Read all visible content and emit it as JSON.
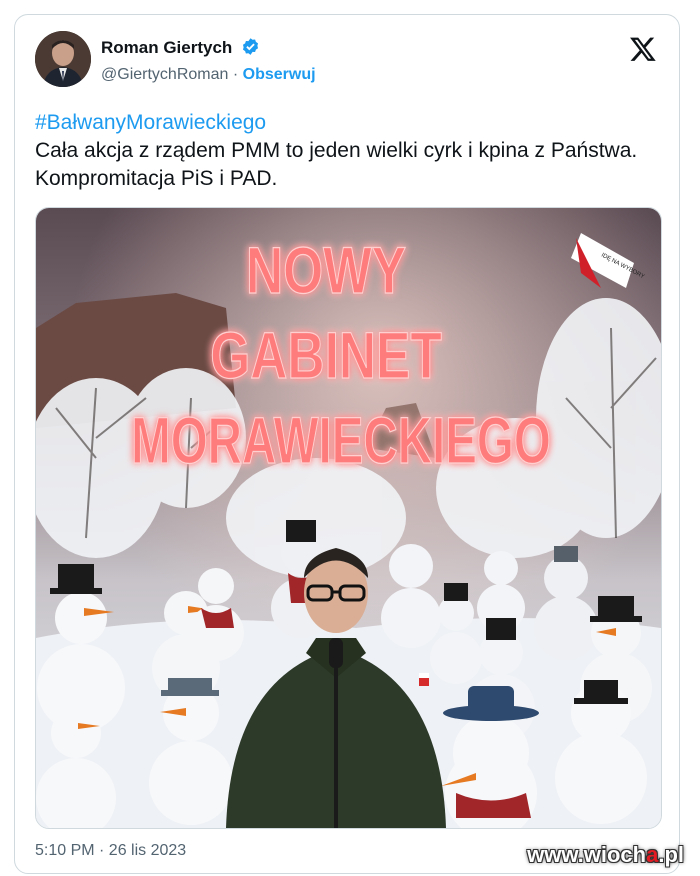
{
  "author": {
    "name": "Roman Giertych",
    "handle": "@GiertychRoman",
    "separator": "·",
    "follow_label": "Obserwuj"
  },
  "tweet": {
    "hashtag": "#BałwanyMorawieckiego",
    "text": "Cała akcja z rządem PMM to jeden wielki cyrk i kpina z Państwa. Kompromitacja PiS i PAD."
  },
  "media": {
    "headline": [
      "NOWY",
      "GABINET",
      "MORAWIECKIEGO"
    ],
    "logo_text": "IDĘ NA WYBORY"
  },
  "timestamp": "5:10 PM · 26 lis 2023",
  "watermark": {
    "prefix": "www.wioch",
    "accent": "a",
    "suffix": ".pl"
  },
  "icons": {
    "verified": "verified-badge-icon",
    "x_logo": "x-logo-icon"
  },
  "colors": {
    "accent": "#1d9bf0",
    "neon": "#ff6a6a"
  }
}
